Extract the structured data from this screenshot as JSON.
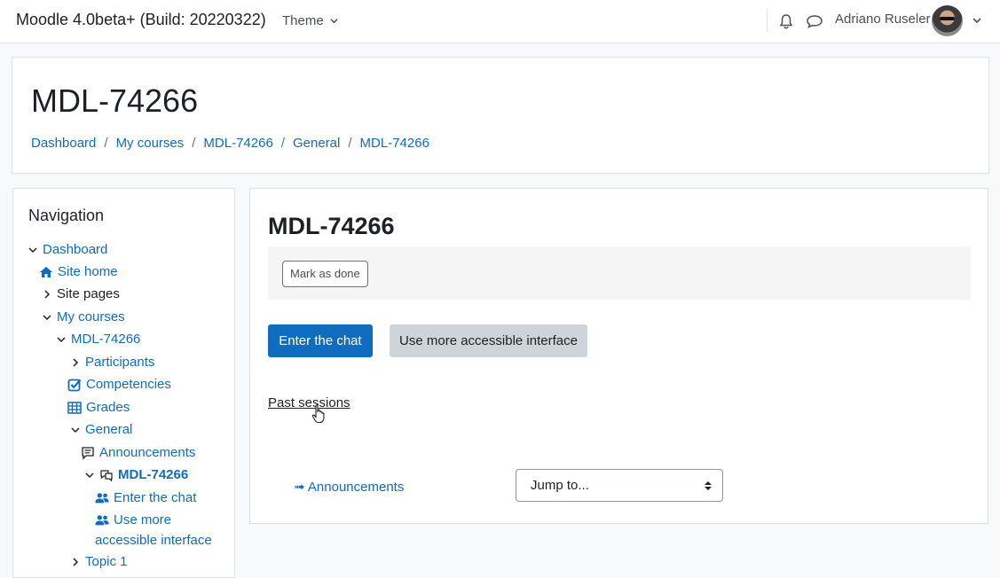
{
  "navbar": {
    "site_name": "Moodle 4.0beta+ (Build: 20220322)",
    "theme_label": "Theme",
    "user_name": "Adriano Ruseler"
  },
  "header": {
    "title": "MDL-74266",
    "breadcrumb": [
      "Dashboard",
      "My courses",
      "MDL-74266",
      "General",
      "MDL-74266"
    ],
    "breadcrumb_separator": "/"
  },
  "navigation": {
    "title": "Navigation",
    "items": [
      {
        "label": "Dashboard"
      },
      {
        "label": "Site home"
      },
      {
        "label": "Site pages"
      },
      {
        "label": "My courses"
      },
      {
        "label": "MDL-74266"
      },
      {
        "label": "Participants"
      },
      {
        "label": "Competencies"
      },
      {
        "label": "Grades"
      },
      {
        "label": "General"
      },
      {
        "label": "Announcements"
      },
      {
        "label": "MDL-74266"
      },
      {
        "label": "Enter the chat"
      },
      {
        "label": "Use more"
      },
      {
        "label": "accessible interface"
      },
      {
        "label": "Topic 1"
      }
    ]
  },
  "main": {
    "title": "MDL-74266",
    "mark_done_label": "Mark as done",
    "enter_chat_label": "Enter the chat",
    "accessible_label": "Use more accessible interface",
    "past_sessions_label": "Past sessions",
    "prev_activity_label": "Announcements",
    "prev_arrow": "➟",
    "jump_to_label": "Jump to..."
  },
  "colors": {
    "link": "#0f6cbf",
    "primary_button": "#0f6cbf",
    "secondary_button": "#ced4da"
  }
}
